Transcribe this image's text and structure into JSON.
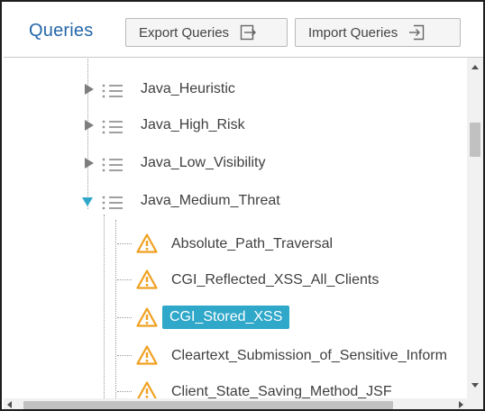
{
  "header": {
    "title": "Queries",
    "export_label": "Export Queries",
    "import_label": "Import Queries"
  },
  "tree": {
    "groups": [
      {
        "label": "Java_Heuristic",
        "expanded": false
      },
      {
        "label": "Java_High_Risk",
        "expanded": false
      },
      {
        "label": "Java_Low_Visibility",
        "expanded": false
      },
      {
        "label": "Java_Medium_Threat",
        "expanded": true
      }
    ],
    "queries": [
      {
        "label": "Absolute_Path_Traversal",
        "selected": false
      },
      {
        "label": "CGI_Reflected_XSS_All_Clients",
        "selected": false
      },
      {
        "label": "CGI_Stored_XSS",
        "selected": true
      },
      {
        "label": "Cleartext_Submission_of_Sensitive_Inform",
        "selected": false
      },
      {
        "label": "Client_State_Saving_Method_JSF",
        "selected": false
      }
    ]
  },
  "colors": {
    "title": "#2567a9",
    "selection": "#2fa8c9",
    "warning": "#f0a020",
    "caret_expanded": "#2fa7c9"
  },
  "icons": {
    "export": "export-icon",
    "import": "import-icon",
    "group": "list-icon",
    "query": "warning-icon"
  }
}
